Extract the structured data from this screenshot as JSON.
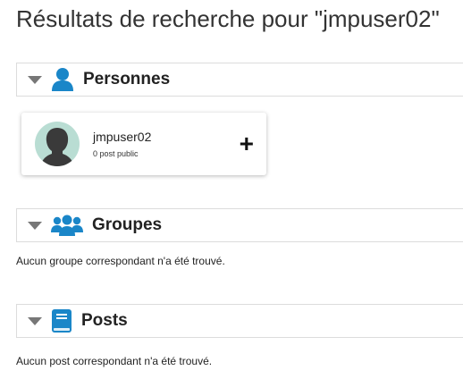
{
  "page": {
    "title": "Résultats de recherche pour \"jmpuser02\""
  },
  "sections": {
    "people": {
      "label": "Personnes",
      "icon": "person-icon",
      "results": [
        {
          "name": "jmpuser02",
          "meta": "0 post public",
          "add_symbol": "+"
        }
      ]
    },
    "groups": {
      "label": "Groupes",
      "icon": "group-icon",
      "empty_message": "Aucun groupe correspondant n'a été trouvé."
    },
    "posts": {
      "label": "Posts",
      "icon": "book-icon",
      "empty_message": "Aucun post correspondant n'a été trouvé."
    }
  },
  "colors": {
    "icon_blue": "#1a86c8",
    "avatar_bg": "#b9ddd3",
    "caret": "#777777"
  }
}
